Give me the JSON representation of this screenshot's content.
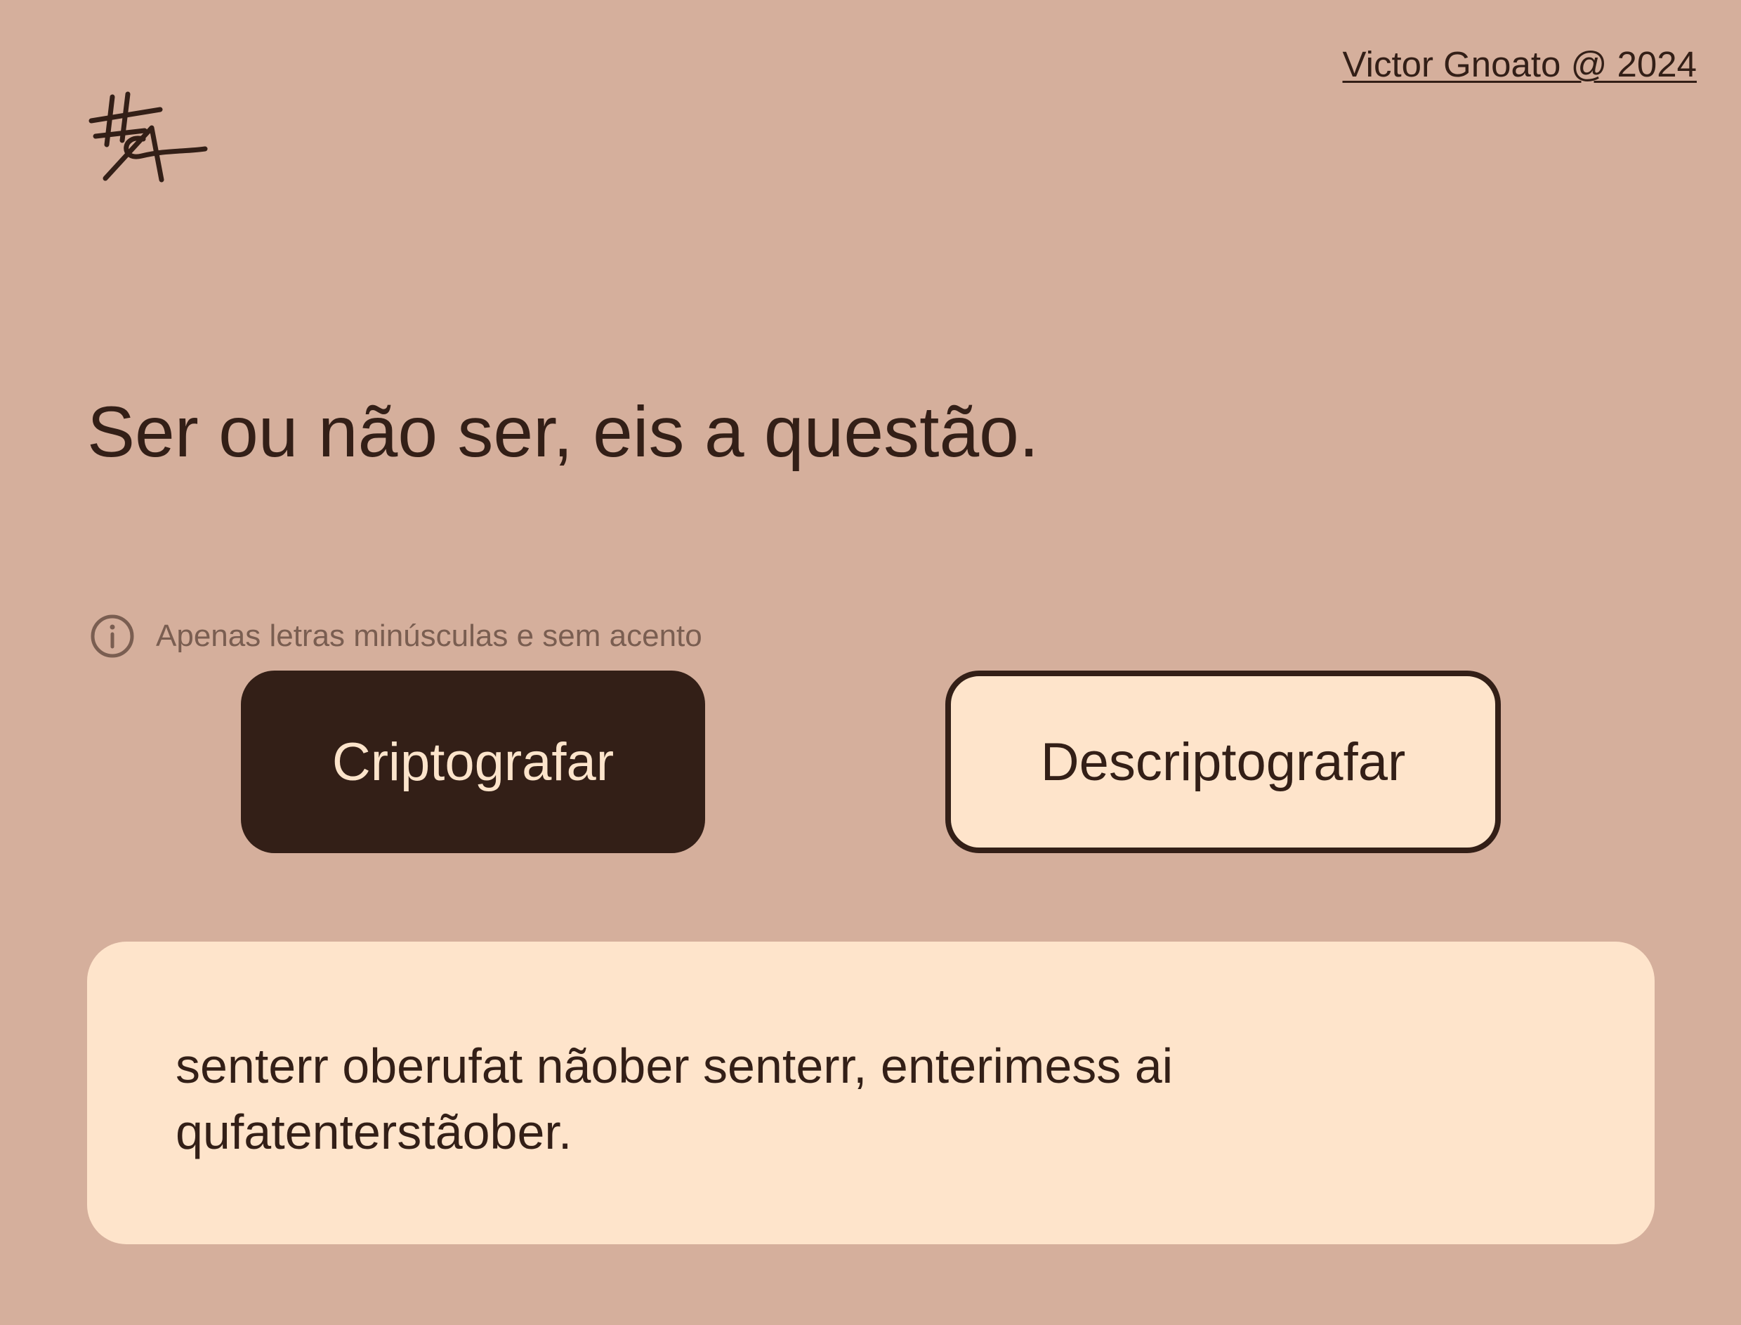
{
  "header": {
    "author_link": "Victor Gnoato @ 2024",
    "logo_icon": "hash-a-signature-logo"
  },
  "input": {
    "text": "Ser ou não ser, eis a questão."
  },
  "hint": {
    "icon": "info-icon",
    "text": "Apenas letras minúsculas e sem acento"
  },
  "actions": {
    "encrypt_label": "Criptografar",
    "decrypt_label": "Descriptografar"
  },
  "output": {
    "text": "senterr oberufat nãober senterr, enterimess ai qufatenterstãober."
  },
  "colors": {
    "background": "#d5af9c",
    "dark": "#331f17",
    "light": "#fee4cb",
    "muted": "#7a5e51"
  }
}
